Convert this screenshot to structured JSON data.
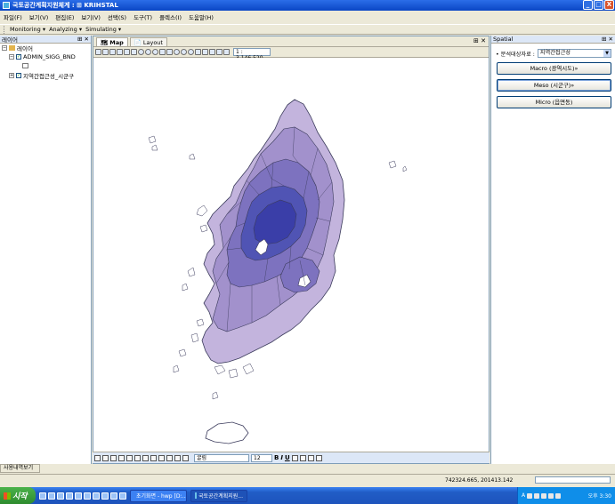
{
  "window": {
    "title": "국토공간계획지원체계 : ⊞ KRIHSTAL",
    "minimize": "_",
    "maximize": "□",
    "close": "X"
  },
  "menu": [
    "파일(F)",
    "보기(V)",
    "편집(E)",
    "보기(V)",
    "선택(S)",
    "도구(T)",
    "플렉스(I)",
    "도움말(H)"
  ],
  "toolbar": {
    "items": [
      "Monitoring ▾",
      "Analyzing ▾",
      "Simulating ▾"
    ]
  },
  "left_panel": {
    "title": "레이어",
    "pin": "⊞ ✕",
    "root": "레이어",
    "layers": [
      {
        "name": "ADMIN_SIGG_BND",
        "checked": true
      },
      {
        "name": "지역간접근성_시군구",
        "checked": true
      }
    ],
    "bottom_tab": "사용내역보기"
  },
  "map_view": {
    "tabs": [
      "Map",
      "Layout"
    ],
    "pin": "⊞ ✕",
    "scale": "1 : 3,146,520",
    "font": "굴림",
    "font_size": "12",
    "colors": {
      "darkest": "#3a3ea8",
      "dark": "#5054b4",
      "mid": "#7d72bf",
      "light": "#a291cc",
      "lightest": "#c3b4dd",
      "outline": "#3b3b5c"
    }
  },
  "right_panel": {
    "title": "Spatial",
    "pin": "⊞ ✕",
    "target_label": "분석대상자료 :",
    "target_value": "지역간접근성",
    "buttons": [
      "Macro (광역시도)»",
      "Meso (시군구)»",
      "Micro (읍면동)"
    ]
  },
  "status": {
    "coords": "742324.665, 201413.142"
  },
  "taskbar": {
    "start": "시작",
    "tasks": [
      "초기화면 - hwp [D:...",
      "국토공간계획지원..."
    ],
    "clock": "오후 3:30"
  }
}
